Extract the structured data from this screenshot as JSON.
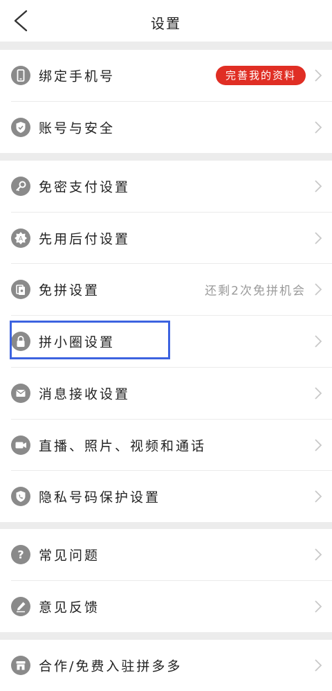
{
  "header": {
    "title": "设置"
  },
  "sections": [
    {
      "items": [
        {
          "label": "绑定手机号",
          "icon": "phone-icon",
          "badge": "完善我的资料"
        },
        {
          "label": "账号与安全",
          "icon": "shield-check-icon"
        }
      ]
    },
    {
      "items": [
        {
          "label": "免密支付设置",
          "icon": "key-icon"
        },
        {
          "label": "先用后付设置",
          "icon": "gear-badge-icon"
        },
        {
          "label": "免拼设置",
          "icon": "card-icon",
          "value": "还剩2次免拼机会"
        },
        {
          "label": "拼小圈设置",
          "icon": "lock-icon"
        },
        {
          "label": "消息接收设置",
          "icon": "mail-icon"
        },
        {
          "label": "直播、照片、视频和通话",
          "icon": "video-camera-icon"
        },
        {
          "label": "隐私号码保护设置",
          "icon": "phone-shield-icon"
        }
      ]
    },
    {
      "items": [
        {
          "label": "常见问题",
          "icon": "question-icon"
        },
        {
          "label": "意见反馈",
          "icon": "pencil-icon"
        }
      ]
    },
    {
      "items": [
        {
          "label": "合作/免费入驻拼多多",
          "icon": "store-icon"
        }
      ]
    }
  ],
  "colors": {
    "accent": "#e02e24",
    "highlight": "#3c63e0",
    "icon": "#8a8a8a",
    "section_gap": "#ececec"
  }
}
